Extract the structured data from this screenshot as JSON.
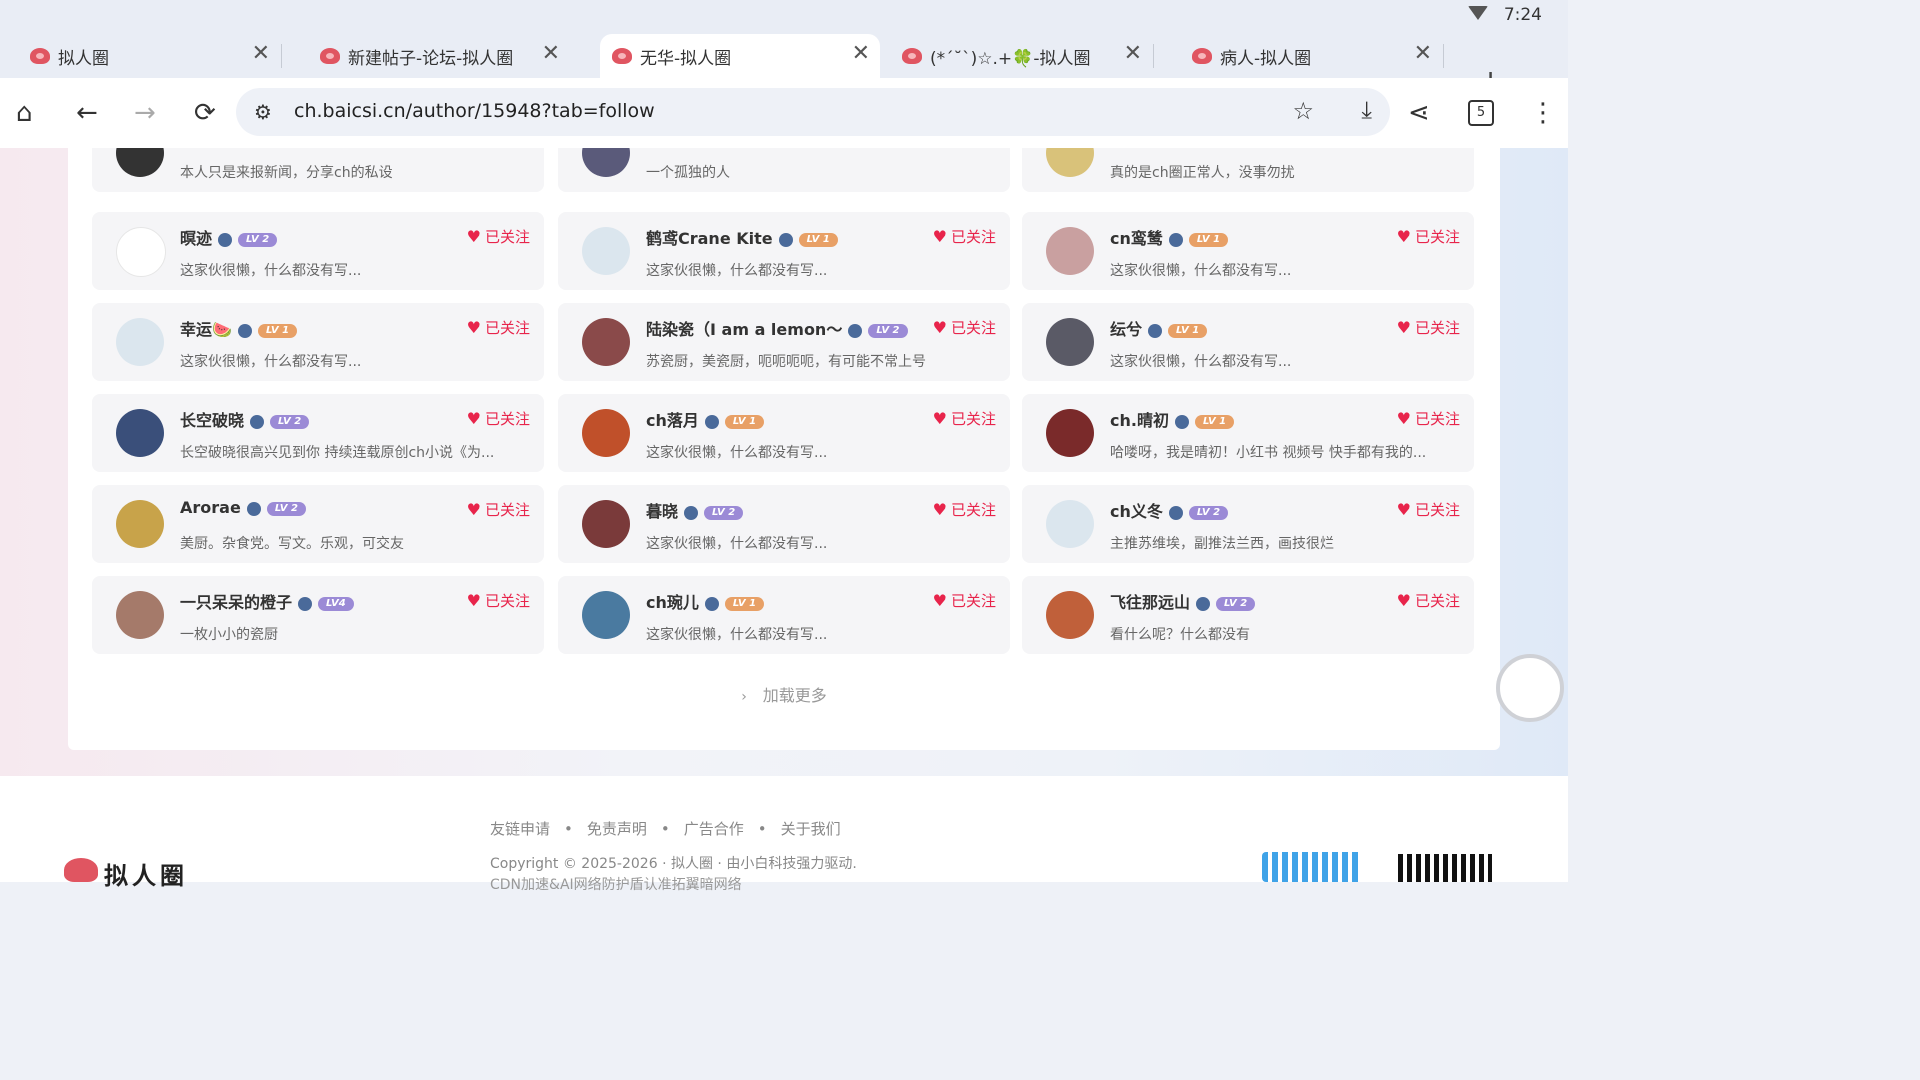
{
  "status": {
    "time": "7:24"
  },
  "tabs": [
    {
      "title": "拟人圈",
      "close": "✕"
    },
    {
      "title": "新建帖子-论坛-拟人圈",
      "close": "✕"
    },
    {
      "title": "无华-拟人圈",
      "close": "✕"
    },
    {
      "title": "(*´˘`)☆.+🍀-拟人圈",
      "close": "✕"
    },
    {
      "title": "病人-拟人圈",
      "close": "✕"
    }
  ],
  "new_tab": "+",
  "toolbar": {
    "home": "⌂",
    "back": "←",
    "forward": "→",
    "reload": "⟳",
    "url": "ch.baicsi.cn/author/15948?tab=follow",
    "tune": "⚙",
    "star": "☆",
    "download": "⤓",
    "share": "⋖",
    "tab_count": "5",
    "menu": "⋮"
  },
  "follow_label": "已关注",
  "heart": "♥",
  "users": [
    {
      "name": "",
      "desc": "本人只是来报新闻，分享ch的私设",
      "lv": "",
      "avatar": "#333"
    },
    {
      "name": "",
      "desc": "一个孤独的人",
      "lv": "",
      "avatar": "#5a5a7a"
    },
    {
      "name": "",
      "desc": "真的是ch圈正常人，没事勿扰",
      "lv": "",
      "avatar": "#d9c27a"
    },
    {
      "name": "暝迹",
      "desc": "这家伙很懒，什么都没有写...",
      "lv": "LV 2",
      "avatar": "#ffffff"
    },
    {
      "name": "鹤鸢Crane Kite",
      "desc": "这家伙很懒，什么都没有写...",
      "lv": "LV 1",
      "avatar": "#dbe6ee"
    },
    {
      "name": "cn鸾鸶",
      "desc": "这家伙很懒，什么都没有写...",
      "lv": "LV 1",
      "avatar": "#c9a0a0"
    },
    {
      "name": "幸运🍉",
      "desc": "这家伙很懒，什么都没有写...",
      "lv": "LV 1",
      "avatar": "#dbe6ee"
    },
    {
      "name": "陆染瓷（I am a lemon～",
      "desc": "苏瓷厨，美瓷厨，呃呃呃呃，有可能不常上号",
      "lv": "LV 2",
      "avatar": "#8a4a4a"
    },
    {
      "name": "纭兮",
      "desc": "这家伙很懒，什么都没有写...",
      "lv": "LV 1",
      "avatar": "#5a5a66"
    },
    {
      "name": "长空破晓",
      "desc": "长空破晓很高兴见到你 持续连载原创ch小说《为...",
      "lv": "LV 2",
      "avatar": "#3a4f7a"
    },
    {
      "name": "ch落月",
      "desc": "这家伙很懒，什么都没有写...",
      "lv": "LV 1",
      "avatar": "#c0502a"
    },
    {
      "name": "ch.晴初",
      "desc": "哈喽呀，我是晴初！小红书 视频号 快手都有我的...",
      "lv": "LV 1",
      "avatar": "#7a2a2a"
    },
    {
      "name": "Arorae",
      "desc": "美厨。杂食党。写文。乐观，可交友",
      "lv": "LV 2",
      "avatar": "#c8a34a"
    },
    {
      "name": "暮晓",
      "desc": "这家伙很懒，什么都没有写...",
      "lv": "LV 2",
      "avatar": "#7a3a3a"
    },
    {
      "name": "ch义冬",
      "desc": "主推苏维埃，副推法兰西，画技很烂",
      "lv": "LV 2",
      "avatar": "#dbe6ee"
    },
    {
      "name": "一只呆呆的橙子",
      "desc": "一枚小小的瓷厨",
      "lv": "LV4",
      "avatar": "#a57a6a"
    },
    {
      "name": "ch琬儿",
      "desc": "这家伙很懒，什么都没有写...",
      "lv": "LV 1",
      "avatar": "#4a7aa0"
    },
    {
      "name": "飞往那远山",
      "desc": "看什么呢？什么都没有",
      "lv": "LV 2",
      "avatar": "#c0603a"
    }
  ],
  "load_more": "加载更多",
  "load_more_icon": "›",
  "footer": {
    "links": [
      "友链申请",
      "免责声明",
      "广告合作",
      "关于我们"
    ],
    "copyright": "Copyright © 2025-2026 · 拟人圈 · 由小白科技强力驱动.",
    "cdn": "CDN加速&AI网络防护盾认准拓翼暗网络",
    "logo": "拟人圈"
  }
}
